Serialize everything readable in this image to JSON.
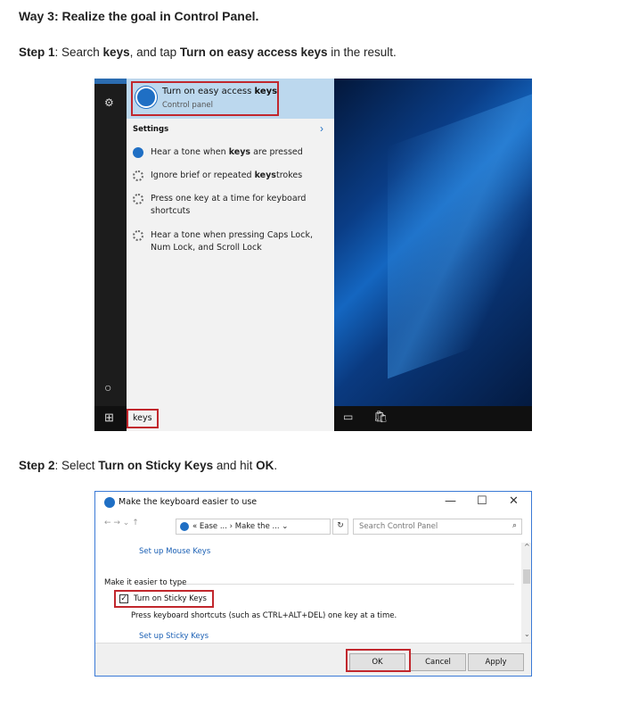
{
  "heading": "Way 3: Realize the goal in Control Panel.",
  "step1": {
    "label": "Step 1",
    "pre": ": Search ",
    "kw": "keys",
    "mid": ", and tap ",
    "target": "Turn on easy access keys",
    "post": " in the result."
  },
  "step2": {
    "label": "Step 2",
    "pre": ": Select ",
    "target": "Turn on Sticky Keys",
    "mid": " and hit ",
    "ok": "OK",
    "post": "."
  },
  "search_panel": {
    "best_title_pre": "Turn on easy access ",
    "best_title_kw": "keys",
    "best_sub": "Control panel",
    "section": "Settings",
    "chevron": "›",
    "items": [
      {
        "pre": "Hear a tone when ",
        "kw": "keys",
        "post": " are pressed",
        "icon": "clock-icon"
      },
      {
        "pre": "Ignore brief or repeated ",
        "kw": "keys",
        "post": "trokes",
        "icon": "gear-icon"
      },
      {
        "l1": "Press one key at a time for keyboard",
        "l2": "shortcuts",
        "icon": "gear-icon"
      },
      {
        "l1": "Hear a tone when pressing Caps Lock,",
        "l2": "Num Lock, and Scroll Lock",
        "icon": "gear-icon"
      }
    ],
    "query": "keys"
  },
  "dialog": {
    "title": "Make the keyboard easier to use",
    "minimize": "—",
    "maximize": "☐",
    "close": "✕",
    "nav": "←   →   ⌄   ↑",
    "breadcrumb": "«  Ease ...  ›  Make the ...        ⌄",
    "refresh": "↻",
    "search_placeholder": "Search Control Panel",
    "search_icon": "⌕",
    "link_mouse": "Set up Mouse Keys",
    "section": "Make it easier to type",
    "checkbox_label": "Turn on Sticky Keys",
    "checkbox_mark": "✓",
    "desc": "Press keyboard shortcuts (such as CTRL+ALT+DEL) one key at a time.",
    "link_sticky": "Set up Sticky Keys",
    "scroll_up": "^",
    "scroll_down": "⌄",
    "ok": "OK",
    "cancel": "Cancel",
    "apply": "Apply"
  },
  "colors": {
    "highlight": "#c1272d",
    "accent": "#1f6fc4"
  }
}
